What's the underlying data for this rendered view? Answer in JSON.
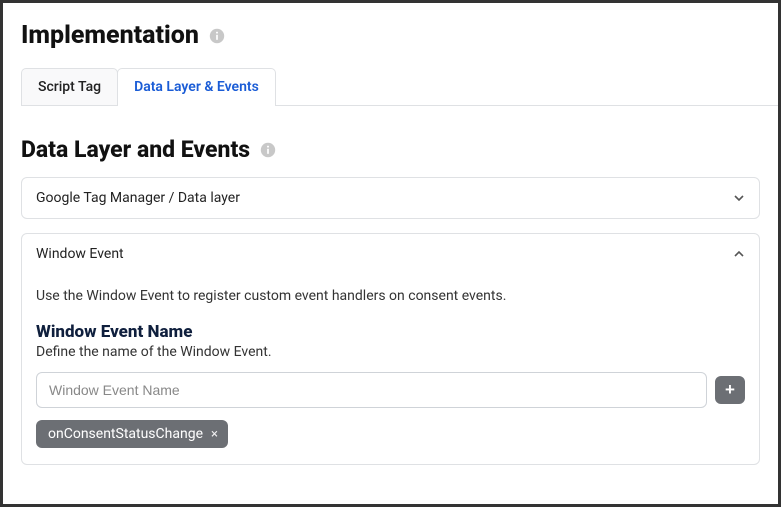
{
  "header": {
    "title": "Implementation"
  },
  "tabs": {
    "script": "Script Tag",
    "datalayer": "Data Layer & Events"
  },
  "section": {
    "title": "Data Layer and Events"
  },
  "gtm": {
    "title": "Google Tag Manager / Data layer"
  },
  "windowEvent": {
    "title": "Window Event",
    "desc": "Use the Window Event to register custom event handlers on consent events.",
    "fieldHeading": "Window Event Name",
    "fieldDesc": "Define the name of the Window Event.",
    "placeholder": "Window Event Name",
    "addLabel": "+",
    "chip": "onConsentStatusChange",
    "chipRemove": "×"
  }
}
